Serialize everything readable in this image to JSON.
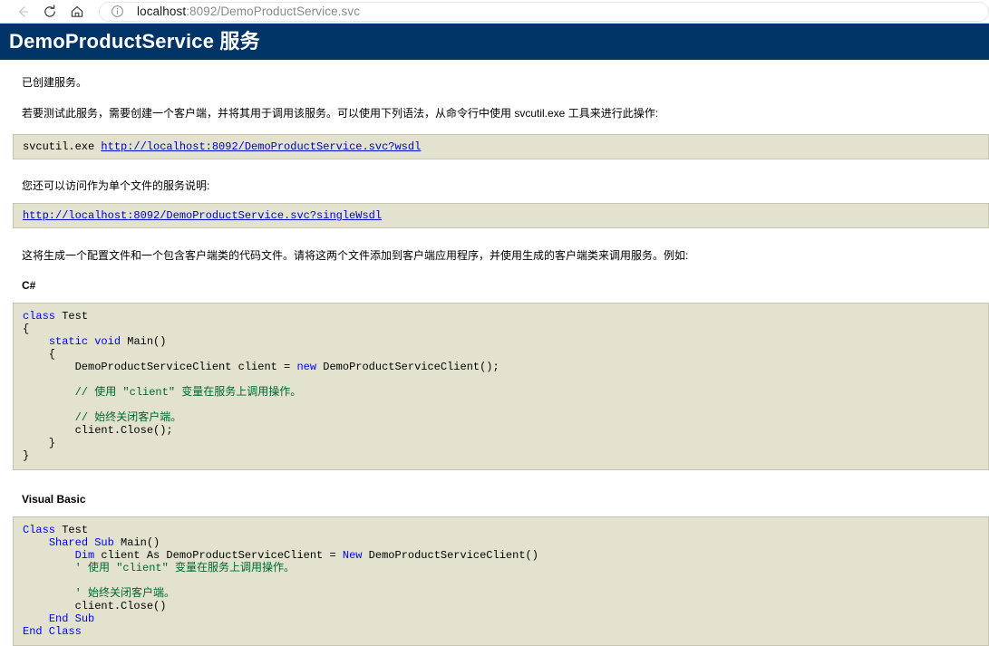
{
  "browser": {
    "back_icon": "back-arrow-icon",
    "reload_icon": "reload-icon",
    "home_icon": "home-icon",
    "site_info_icon": "info-circle-icon",
    "url_host": "localhost",
    "url_rest": ":8092/DemoProductService.svc",
    "url_full": "localhost:8092/DemoProductService.svc"
  },
  "header": {
    "title": "DemoProductService 服务",
    "background_color": "#003366",
    "text_color": "#ffffff"
  },
  "content": {
    "created": "已创建服务。",
    "test_instructions": "若要测试此服务，需要创建一个客户端，并将其用于调用该服务。可以使用下列语法，从命令行中使用 svcutil.exe 工具来进行此操作:",
    "svcutil_command_prefix": "svcutil.exe ",
    "wsdl_url": "http://localhost:8092/DemoProductService.svc?wsdl",
    "singlewsdl_intro": "您还可以访问作为单个文件的服务说明:",
    "singlewsdl_url": "http://localhost:8092/DemoProductService.svc?singleWsdl",
    "generate_note": "这将生成一个配置文件和一个包含客户端类的代码文件。请将这两个文件添加到客户端应用程序，并使用生成的客户端类来调用服务。例如:",
    "csharp_heading": "C#",
    "vb_heading": "Visual Basic"
  },
  "code": {
    "csharp": {
      "l1_kw": "class",
      "l1_rest": " Test",
      "l2": "{",
      "l3_indent": "    ",
      "l3_kw1": "static",
      "l3_kw2": "void",
      "l3_rest": " Main()",
      "l4": "    {",
      "l5_pre": "        DemoProductServiceClient client = ",
      "l5_kw": "new",
      "l5_post": " DemoProductServiceClient();",
      "l6": "",
      "l7_comment": "        // 使用 \"client\" 变量在服务上调用操作。",
      "l8": "",
      "l9_comment": "        // 始终关闭客户端。",
      "l10": "        client.Close();",
      "l11": "    }",
      "l12": "}"
    },
    "vb": {
      "l1_kw": "Class",
      "l1_rest": " Test",
      "l2_indent": "    ",
      "l2_kw1": "Shared",
      "l2_kw2": "Sub",
      "l2_rest": " Main()",
      "l3_indent": "        ",
      "l3_kw1": "Dim",
      "l3_mid": " client As DemoProductServiceClient = ",
      "l3_kw2": "New",
      "l3_post": " DemoProductServiceClient()",
      "l4_comment": "        ' 使用 \"client\" 变量在服务上调用操作。",
      "l5": "",
      "l6_comment": "        ' 始终关闭客户端。",
      "l7": "        client.Close()",
      "l8_indent": "    ",
      "l8_kw": "End Sub",
      "l9_kw": "End Class"
    }
  },
  "colors": {
    "banner": "#003366",
    "code_background": "#e2e2ce",
    "code_border": "#c5c5b0",
    "keyword": "#0000ff",
    "comment": "#006633",
    "link": "#0000cc"
  }
}
